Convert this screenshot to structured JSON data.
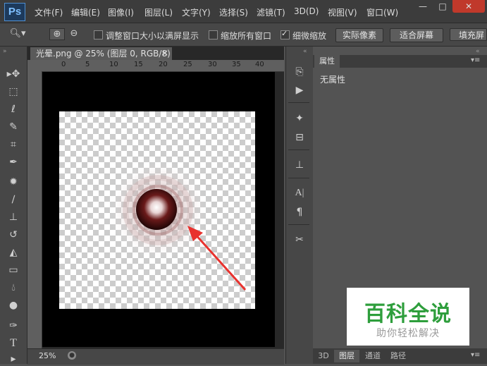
{
  "app": {
    "logo": "Ps"
  },
  "menu": [
    "文件(F)",
    "编辑(E)",
    "图像(I)",
    "图层(L)",
    "文字(Y)",
    "选择(S)",
    "滤镜(T)",
    "3D(D)",
    "视图(V)",
    "窗口(W)"
  ],
  "window_controls": {
    "minimize": "—",
    "maximize": "□",
    "close": "✕"
  },
  "options": {
    "resize_window_label": "调整窗口大小以满屏显示",
    "zoom_all_label": "缩放所有窗口",
    "scrubby_zoom_label": "细微缩放",
    "scrubby_zoom_checked": true,
    "actual_pixels_button": "实际像素",
    "fit_screen_button": "适合屏幕",
    "fill_screen_button": "填充屏"
  },
  "document": {
    "tab_title": "光晕.png @ 25% (图层 0, RGB/8)",
    "tab_close": "×",
    "ruler_marks": [
      "0",
      "5",
      "10",
      "15",
      "20",
      "25",
      "30",
      "35",
      "40"
    ],
    "zoom": "25%"
  },
  "properties_panel": {
    "tab_label": "属性",
    "empty_text": "无属性"
  },
  "bottom_tabs": [
    "3D",
    "图层",
    "通道",
    "路径"
  ],
  "watermark": {
    "title": "百科全说",
    "subtitle": "助你轻松解决"
  },
  "colors": {
    "accent_green": "#2e9e3c",
    "arrow_red": "#e8322e",
    "orb_dark": "#3a0c0c"
  }
}
